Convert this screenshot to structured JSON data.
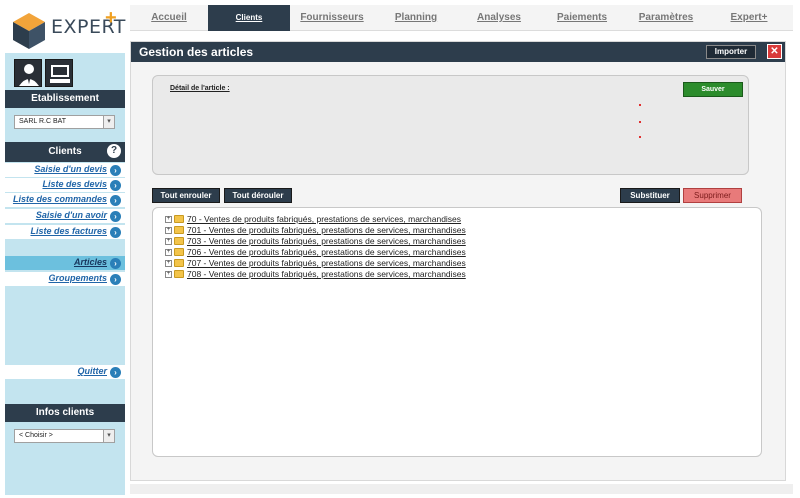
{
  "brand": {
    "logo_text": "EXPERT",
    "logo_plus": "+"
  },
  "sidebar": {
    "establishment_header": "Etablissement",
    "establishment_select": "SARL R.C BAT",
    "clients_header": "Clients",
    "help_glyph": "?",
    "items": [
      {
        "label": "Saisie d'un devis"
      },
      {
        "label": "Liste des devis"
      },
      {
        "label": "Liste des commandes"
      },
      {
        "label": "Saisie d'un avoir"
      },
      {
        "label": "Liste des factures"
      },
      {
        "label": "Articles"
      },
      {
        "label": "Groupements"
      },
      {
        "label": "Quitter"
      }
    ],
    "active_item": "Articles",
    "infos_header": "Infos clients",
    "infos_select": "< Choisir >"
  },
  "topnav": {
    "tabs": [
      {
        "label": "Accueil"
      },
      {
        "label": "Clients"
      },
      {
        "label": "Fournisseurs"
      },
      {
        "label": "Planning"
      },
      {
        "label": "Analyses"
      },
      {
        "label": "Paiements"
      },
      {
        "label": "Paramètres"
      },
      {
        "label": "Expert+"
      }
    ],
    "active_tab": "Clients"
  },
  "panel": {
    "title": "Gestion des articles",
    "import_label": "Importer",
    "close_glyph": "✕",
    "detail_label": "Détail de l'article :",
    "save_label": "Sauver",
    "collapse_all_label": "Tout enrouler",
    "expand_all_label": "Tout dérouler",
    "substitute_label": "Substituer",
    "delete_label": "Supprimer",
    "tree": [
      {
        "expander": "+",
        "label": "70 - Ventes de produits fabriqués, prestations de services, marchandises"
      },
      {
        "expander": "+",
        "label": "701 - Ventes de produits fabriqués, prestations de services, marchandises"
      },
      {
        "expander": "+",
        "label": "703 - Ventes de produits fabriqués, prestations de services, marchandises"
      },
      {
        "expander": "+",
        "label": "706 - Ventes de produits fabriqués, prestations de services, marchandises"
      },
      {
        "expander": "+",
        "label": "707 - Ventes de produits fabriqués, prestations de services, marchandises"
      },
      {
        "expander": "+",
        "label": "708 - Ventes de produits fabriqués, prestations de services, marchandises"
      }
    ]
  },
  "colors": {
    "header_dark": "#2d3d4c",
    "sidebar_bg": "#c3e4ef",
    "active_item": "#6cc0de",
    "save_green": "#2c8c2c",
    "delete_red": "#e87a7a"
  },
  "icons": [
    "expert-cube-logo-icon",
    "user-profile-icon",
    "computer-icon",
    "help-icon",
    "chevron-right-icon",
    "folder-icon",
    "close-icon",
    "dropdown-arrow-icon"
  ]
}
